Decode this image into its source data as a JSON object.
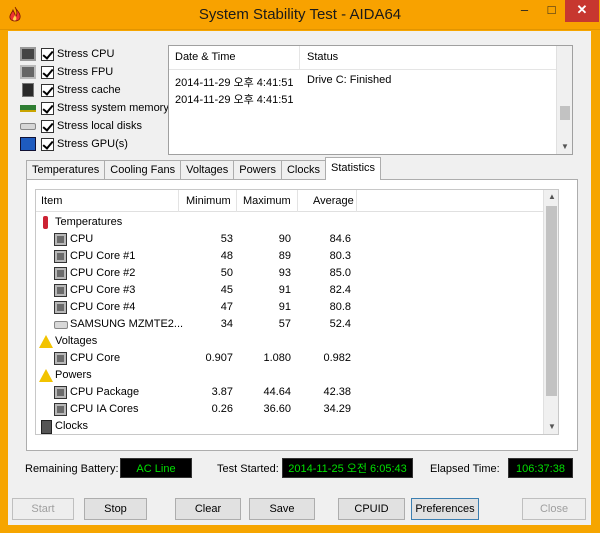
{
  "window": {
    "title": "System Stability Test - AIDA64",
    "minimize_glyph": "–",
    "maximize_glyph": "□",
    "close_glyph": "✕"
  },
  "stress_options": [
    {
      "label": "Stress CPU",
      "checked": true,
      "icon": "cpu-icon"
    },
    {
      "label": "Stress FPU",
      "checked": true,
      "icon": "fpu-icon"
    },
    {
      "label": "Stress cache",
      "checked": true,
      "icon": "cache-icon"
    },
    {
      "label": "Stress system memory",
      "checked": true,
      "icon": "memory-icon"
    },
    {
      "label": "Stress local disks",
      "checked": true,
      "icon": "disk-icon"
    },
    {
      "label": "Stress GPU(s)",
      "checked": true,
      "icon": "gpu-icon"
    }
  ],
  "log": {
    "columns": [
      "Date & Time",
      "Status"
    ],
    "rows": [
      {
        "datetime": "2014-11-29 오후 4:41:51",
        "status": "Drive C: Finished"
      },
      {
        "datetime": "2014-11-29 오후 4:41:51",
        "status": ""
      }
    ]
  },
  "tabs": [
    "Temperatures",
    "Cooling Fans",
    "Voltages",
    "Powers",
    "Clocks",
    "Statistics"
  ],
  "active_tab": "Statistics",
  "stats": {
    "columns": [
      "Item",
      "Minimum",
      "Maximum",
      "Average"
    ],
    "rows": [
      {
        "type": "group",
        "name": "Temperatures",
        "icon": "thermometer-icon"
      },
      {
        "type": "item",
        "name": "CPU",
        "min": "53",
        "max": "90",
        "avg": "84.6",
        "icon": "chip-icon"
      },
      {
        "type": "item",
        "name": "CPU Core #1",
        "min": "48",
        "max": "89",
        "avg": "80.3",
        "icon": "chip-icon"
      },
      {
        "type": "item",
        "name": "CPU Core #2",
        "min": "50",
        "max": "93",
        "avg": "85.0",
        "icon": "chip-icon"
      },
      {
        "type": "item",
        "name": "CPU Core #3",
        "min": "45",
        "max": "91",
        "avg": "82.4",
        "icon": "chip-icon"
      },
      {
        "type": "item",
        "name": "CPU Core #4",
        "min": "47",
        "max": "91",
        "avg": "80.8",
        "icon": "chip-icon"
      },
      {
        "type": "item",
        "name": "SAMSUNG MZMTE2...",
        "min": "34",
        "max": "57",
        "avg": "52.4",
        "icon": "disk-icon"
      },
      {
        "type": "group",
        "name": "Voltages",
        "icon": "warning-icon"
      },
      {
        "type": "item",
        "name": "CPU Core",
        "min": "0.907",
        "max": "1.080",
        "avg": "0.982",
        "icon": "chip-icon"
      },
      {
        "type": "group",
        "name": "Powers",
        "icon": "warning-icon"
      },
      {
        "type": "item",
        "name": "CPU Package",
        "min": "3.87",
        "max": "44.64",
        "avg": "42.38",
        "icon": "chip-icon"
      },
      {
        "type": "item",
        "name": "CPU IA Cores",
        "min": "0.26",
        "max": "36.60",
        "avg": "34.29",
        "icon": "chip-icon"
      },
      {
        "type": "group",
        "name": "Clocks",
        "icon": "clock-icon"
      }
    ]
  },
  "status": {
    "battery_label": "Remaining Battery:",
    "battery_value": "AC Line",
    "started_label": "Test Started:",
    "started_value": "2014-11-25 오전 6:05:43",
    "elapsed_label": "Elapsed Time:",
    "elapsed_value": "106:37:38"
  },
  "buttons": {
    "start": "Start",
    "stop": "Stop",
    "clear": "Clear",
    "save": "Save",
    "cpuid": "CPUID",
    "preferences": "Preferences",
    "close": "Close"
  },
  "colors": {
    "titlebar": "#f8a200",
    "status_text": "#00e000",
    "status_bg": "#000000"
  }
}
